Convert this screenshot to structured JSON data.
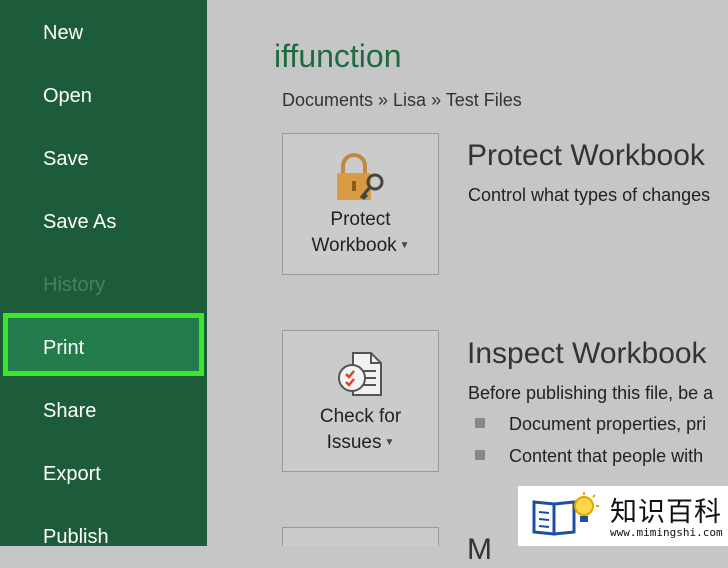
{
  "sidebar": {
    "items": [
      {
        "label": "New",
        "enabled": true
      },
      {
        "label": "Open",
        "enabled": true
      },
      {
        "label": "Save",
        "enabled": true
      },
      {
        "label": "Save As",
        "enabled": true
      },
      {
        "label": "History",
        "enabled": false
      },
      {
        "label": "Print",
        "enabled": true,
        "highlighted": true
      },
      {
        "label": "Share",
        "enabled": true
      },
      {
        "label": "Export",
        "enabled": true
      },
      {
        "label": "Publish",
        "enabled": true
      }
    ],
    "background": "#1d5c3a",
    "highlight_color": "#39e82a"
  },
  "main": {
    "title": "iffunction",
    "breadcrumb": "Documents » Lisa » Test Files",
    "sections": [
      {
        "button_line1": "Protect",
        "button_line2": "Workbook",
        "button_icon": "lock-key-icon",
        "heading": "Protect Workbook",
        "description": "Control what types of changes"
      },
      {
        "button_line1": "Check for",
        "button_line2": "Issues",
        "button_icon": "inspect-document-icon",
        "heading": "Inspect Workbook",
        "description": "Before publishing this file, be a",
        "bullets": [
          "Document properties, pri",
          "Content that people with"
        ]
      },
      {
        "heading": "M"
      }
    ]
  },
  "watermark": {
    "text": "知识百科",
    "url": "www.mimingshi.com"
  }
}
